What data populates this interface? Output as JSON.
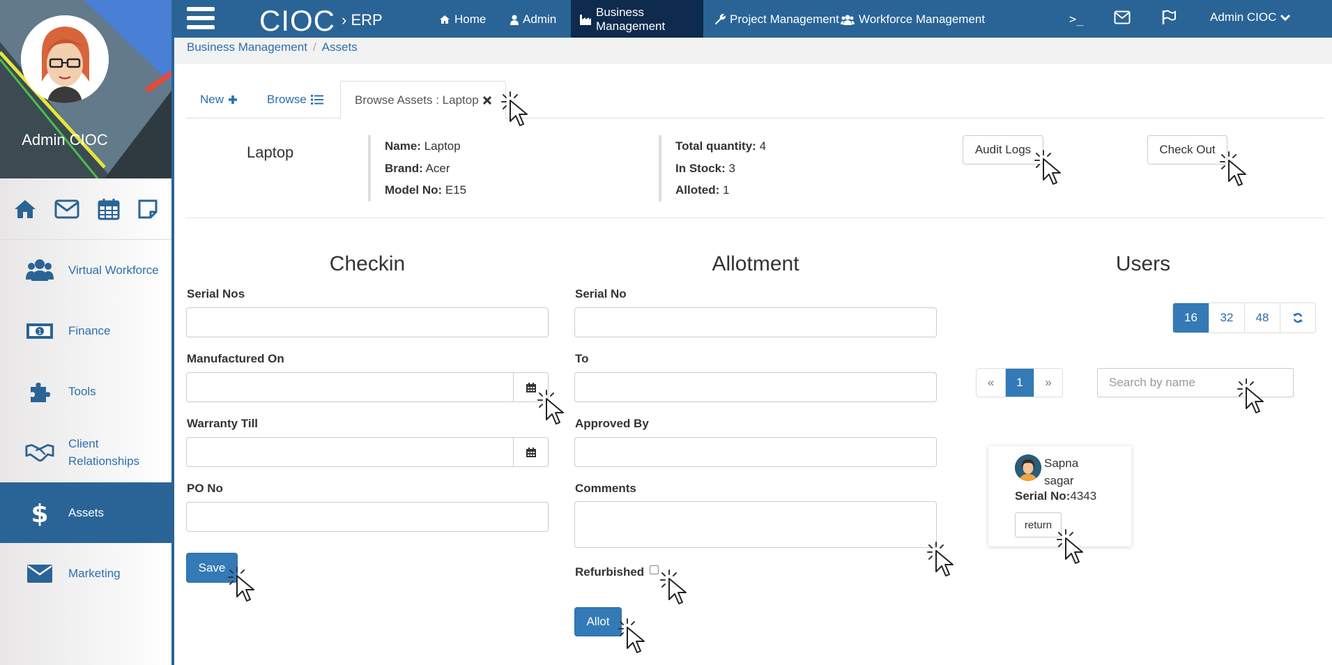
{
  "sidebar": {
    "profile_name": "Admin CIOC",
    "quick_icons": [
      "home-icon",
      "envelope-icon",
      "calendar-icon",
      "sticky-note-icon"
    ],
    "items": [
      {
        "label": "Virtual Workforce",
        "icon": "users-icon"
      },
      {
        "label": "Finance",
        "icon": "money-icon"
      },
      {
        "label": "Tools",
        "icon": "puzzle-icon"
      },
      {
        "label": "Client Relationships",
        "icon": "handshake-icon"
      },
      {
        "label": "Assets",
        "icon": "dollar-icon",
        "active": true
      },
      {
        "label": "Marketing",
        "icon": "envelope-icon"
      }
    ]
  },
  "topbar": {
    "brand": "CIOC",
    "brand_sub": "› ERP",
    "nav": [
      {
        "label": "Home",
        "icon": "home-icon"
      },
      {
        "label": "Admin",
        "icon": "user-icon"
      },
      {
        "label": "Business Management",
        "icon": "industry-icon",
        "active": true
      },
      {
        "label": "Project Management",
        "icon": "wrench-icon"
      },
      {
        "label": "Workforce Management",
        "icon": "users-icon"
      }
    ],
    "terminal": ">_",
    "user_menu": "Admin CIOC"
  },
  "breadcrumb": [
    "Business Management",
    "Assets"
  ],
  "tabs": [
    {
      "label": "New",
      "icon": "plus-icon"
    },
    {
      "label": "Browse",
      "icon": "list-icon"
    },
    {
      "label": "Browse Assets : Laptop",
      "icon": "close-icon",
      "active": true
    }
  ],
  "asset": {
    "title": "Laptop",
    "details": [
      {
        "label": "Name:",
        "value": "Laptop"
      },
      {
        "label": "Brand:",
        "value": "Acer"
      },
      {
        "label": "Model No:",
        "value": "E15"
      }
    ],
    "stock": [
      {
        "label": "Total quantity:",
        "value": "4"
      },
      {
        "label": "In Stock:",
        "value": "3"
      },
      {
        "label": "Alloted:",
        "value": "1"
      }
    ],
    "audit_logs": "Audit Logs",
    "check_out": "Check Out"
  },
  "checkin": {
    "title": "Checkin",
    "serial_nos": "Serial Nos",
    "manufactured_on": "Manufactured On",
    "warranty_till": "Warranty Till",
    "po_no": "PO No",
    "save": "Save"
  },
  "allotment": {
    "title": "Allotment",
    "serial_no": "Serial No",
    "to": "To",
    "approved_by": "Approved By",
    "comments": "Comments",
    "refurbished": "Refurbished",
    "allot": "Allot"
  },
  "users": {
    "title": "Users",
    "page_sizes": [
      "16",
      "32",
      "48"
    ],
    "active_page_size": "16",
    "pagination": [
      "«",
      "1",
      "»"
    ],
    "search_placeholder": "Search by name",
    "card": {
      "name": "Sapna sagar",
      "serial_label": "Serial No:",
      "serial_value": "4343",
      "return_label": "return"
    }
  },
  "colors": {
    "primary": "#2a6496",
    "button_primary": "#337ab7",
    "active_top_nav": "#0e2a4d",
    "link": "#2a6fb0"
  }
}
